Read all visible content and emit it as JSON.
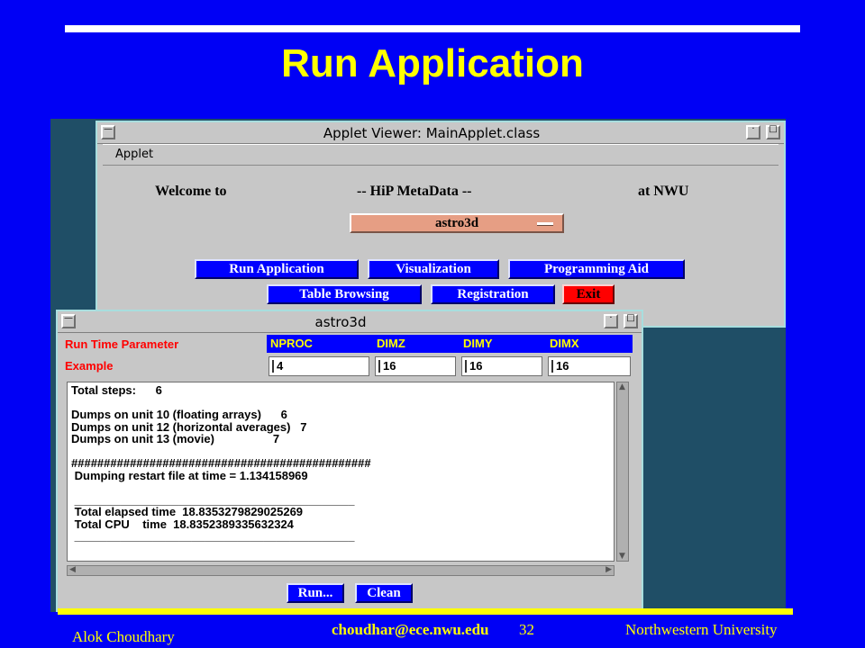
{
  "slide": {
    "title": "Run Application"
  },
  "applet_window": {
    "title": "Applet Viewer: MainApplet.class",
    "menu": "Applet",
    "welcome_left": "Welcome to",
    "welcome_mid": "-- HiP MetaData --",
    "welcome_right": "at NWU",
    "dataset_selected": "astro3d",
    "buttons": {
      "run_application": "Run Application",
      "visualization": "Visualization",
      "programming_aid": "Programming Aid",
      "table_browsing": "Table Browsing",
      "registration": "Registration",
      "exit": "Exit"
    }
  },
  "astro_window": {
    "title": "astro3d",
    "row1_label": "Run Time Parameter",
    "row2_label": "Example",
    "headers": [
      "NPROC",
      "DIMZ",
      "DIMY",
      "DIMX"
    ],
    "values": [
      "4",
      "16",
      "16",
      "16"
    ],
    "log_text": "Total steps:      6\n\nDumps on unit 10 (floating arrays)      6\nDumps on unit 12 (horizontal averages)   7\nDumps on unit 13 (movie)                  7\n\n##############################################\n Dumping restart file at time = 1.134158969\n\n ___________________________________________\n Total elapsed time  18.8353279829025269\n Total CPU    time  18.8352389335632324\n ___________________________________________",
    "run_button": "Run...",
    "clean_button": "Clean"
  },
  "footer": {
    "author": "Alok Choudhary",
    "email": "choudhar@ece.nwu.edu",
    "page": "32",
    "affiliation": "Northwestern University"
  },
  "colors": {
    "slide_background": "#0000f5",
    "title_color": "#ffff00",
    "button_blue": "#0000ff",
    "exit_red": "#ff0000",
    "choice_salmon": "#e69e84"
  }
}
